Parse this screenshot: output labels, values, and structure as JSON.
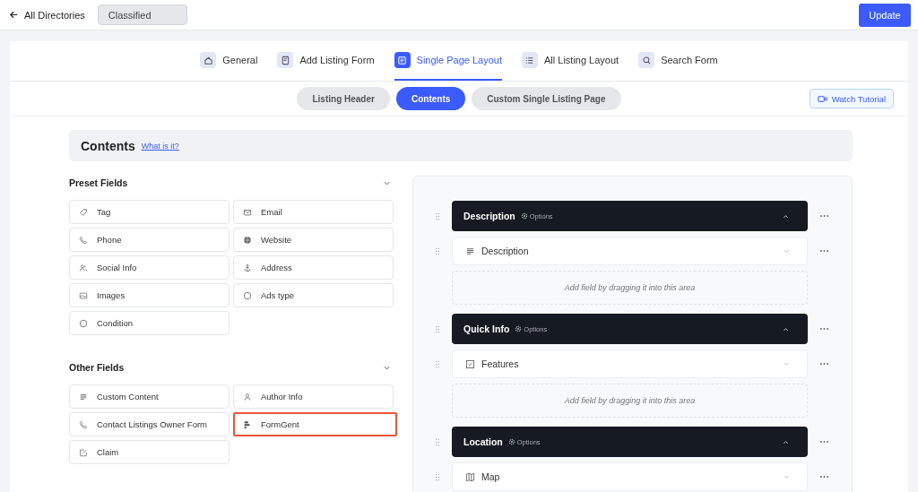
{
  "topbar": {
    "back": "All Directories",
    "directory": "Classified",
    "update": "Update"
  },
  "tabs": [
    {
      "label": "General",
      "selected": false
    },
    {
      "label": "Add Listing Form",
      "selected": false
    },
    {
      "label": "Single Page Layout",
      "selected": true
    },
    {
      "label": "All Listing Layout",
      "selected": false
    },
    {
      "label": "Search Form",
      "selected": false
    }
  ],
  "subtabs": [
    {
      "label": "Listing Header",
      "selected": false
    },
    {
      "label": "Contents",
      "selected": true
    },
    {
      "label": "Custom Single Listing Page",
      "selected": false
    }
  ],
  "tutorial": "Watch Tutorial",
  "heading": {
    "title": "Contents",
    "link": "What is it?"
  },
  "field_groups": [
    {
      "title": "Preset Fields",
      "expanded": true,
      "items": [
        {
          "label": "Tag",
          "highlighted": false
        },
        {
          "label": "Email",
          "highlighted": false
        },
        {
          "label": "Phone",
          "highlighted": false
        },
        {
          "label": "Website",
          "highlighted": false
        },
        {
          "label": "Social Info",
          "highlighted": false
        },
        {
          "label": "Address",
          "highlighted": false
        },
        {
          "label": "Images",
          "highlighted": false
        },
        {
          "label": "Ads type",
          "highlighted": false
        },
        {
          "label": "Condition",
          "highlighted": false
        }
      ]
    },
    {
      "title": "Other Fields",
      "expanded": true,
      "items": [
        {
          "label": "Custom Content",
          "highlighted": false
        },
        {
          "label": "Author Info",
          "highlighted": false
        },
        {
          "label": "Contact Listings Owner Form",
          "highlighted": false
        },
        {
          "label": "FormGent",
          "highlighted": true
        },
        {
          "label": "Claim",
          "highlighted": false
        }
      ]
    }
  ],
  "sections": [
    {
      "title": "Description",
      "options": "Options",
      "expanded": true,
      "fields": [
        {
          "label": "Description",
          "expanded": false
        }
      ],
      "dropzone": "Add field by dragging it into this area"
    },
    {
      "title": "Quick Info",
      "options": "Options",
      "expanded": true,
      "fields": [
        {
          "label": "Features",
          "expanded": false
        }
      ],
      "dropzone": "Add field by dragging it into this area"
    },
    {
      "title": "Location",
      "options": "Options",
      "expanded": true,
      "fields": [
        {
          "label": "Map",
          "expanded": false
        }
      ]
    }
  ]
}
